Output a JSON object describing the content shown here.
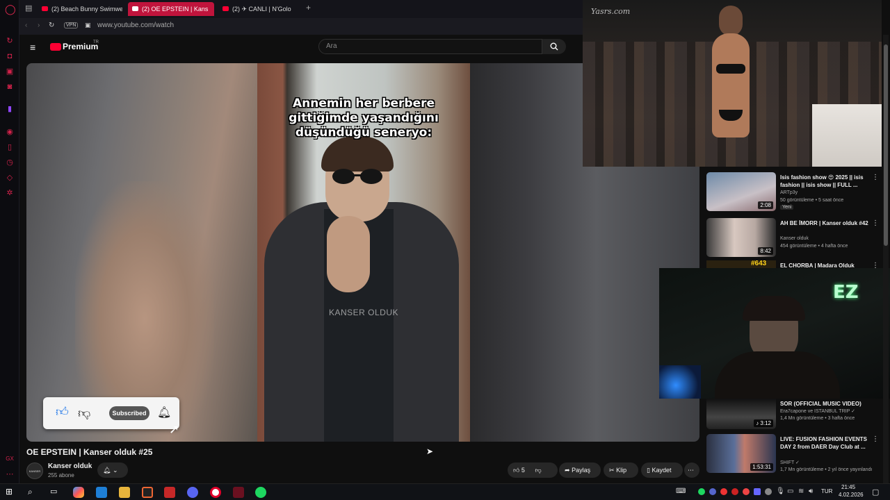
{
  "browser": {
    "tabs": [
      {
        "label": "(2) Beach Bunny Swimwe",
        "active": false
      },
      {
        "label": "(2) OE EPSTEIN | Kans",
        "active": true
      },
      {
        "label": "(2) ✈ CANLI | N'Golo",
        "active": false
      }
    ],
    "address": "www.youtube.com/watch",
    "vpn_label": "VPN"
  },
  "youtube": {
    "logo_text": "Premium",
    "logo_sup": "TR",
    "search_placeholder": "Ara"
  },
  "video": {
    "caption": "Annemin her berbere gittiğimde yaşandığını düşündüğü seneryo:",
    "watermark": "KANSER OLDUK",
    "subscribe_overlay_label": "Subscribed",
    "title": "OE EPSTEIN | Kanser olduk #25",
    "channel_name": "Kanser olduk",
    "channel_avatar_text": "KANSER OLDUK",
    "subscribers": "255 abone",
    "like_count": "5",
    "share_label": "Paylaş",
    "clip_label": "Klip",
    "save_label": "Kaydet"
  },
  "recommendations": [
    {
      "title": "Isis fashion show 😍 2025 || isis fashion || isis show || FULL ...",
      "channel": "ARTp3y",
      "meta": "50 görüntüleme • 5 saat önce",
      "duration": "2:08",
      "badge": "Yeni"
    },
    {
      "title": "AH BE İMORR | Kanser olduk #42",
      "channel": "Kanser olduk",
      "meta": "454 görüntüleme • 4 hafta önce",
      "duration": "8:42",
      "badge": ""
    },
    {
      "title": "EL CHORBA | Madara Olduk",
      "channel": "",
      "meta": "",
      "duration": "",
      "badge": "",
      "thumb_text": "#643"
    },
    {
      "title": "SOR (OFFICIAL MUSIC VIDEO)",
      "channel": "Era7capone ve ISTANBUL TRIP ✓",
      "meta": "1,4 Mn görüntüleme • 3 hafta önce",
      "duration": "♪ 3:12",
      "badge": ""
    },
    {
      "title": "LIVE: FUSION FASHION EVENTS DAY 2 from DAER Day Club at ...",
      "channel": "SHIFT ✓",
      "meta": "1,7 Mn görüntüleme • 2 yıl önce yayınlandı",
      "duration": "1:53:31",
      "badge": ""
    }
  ],
  "overlays": {
    "runway_logo": "Yasrs.com",
    "webcam_sign": "EZ"
  },
  "taskbar": {
    "lang": "TUR",
    "time": "21:45",
    "date": "4.02.2026"
  },
  "colors": {
    "accent": "#c0143c",
    "yt_red": "#ff0033"
  }
}
